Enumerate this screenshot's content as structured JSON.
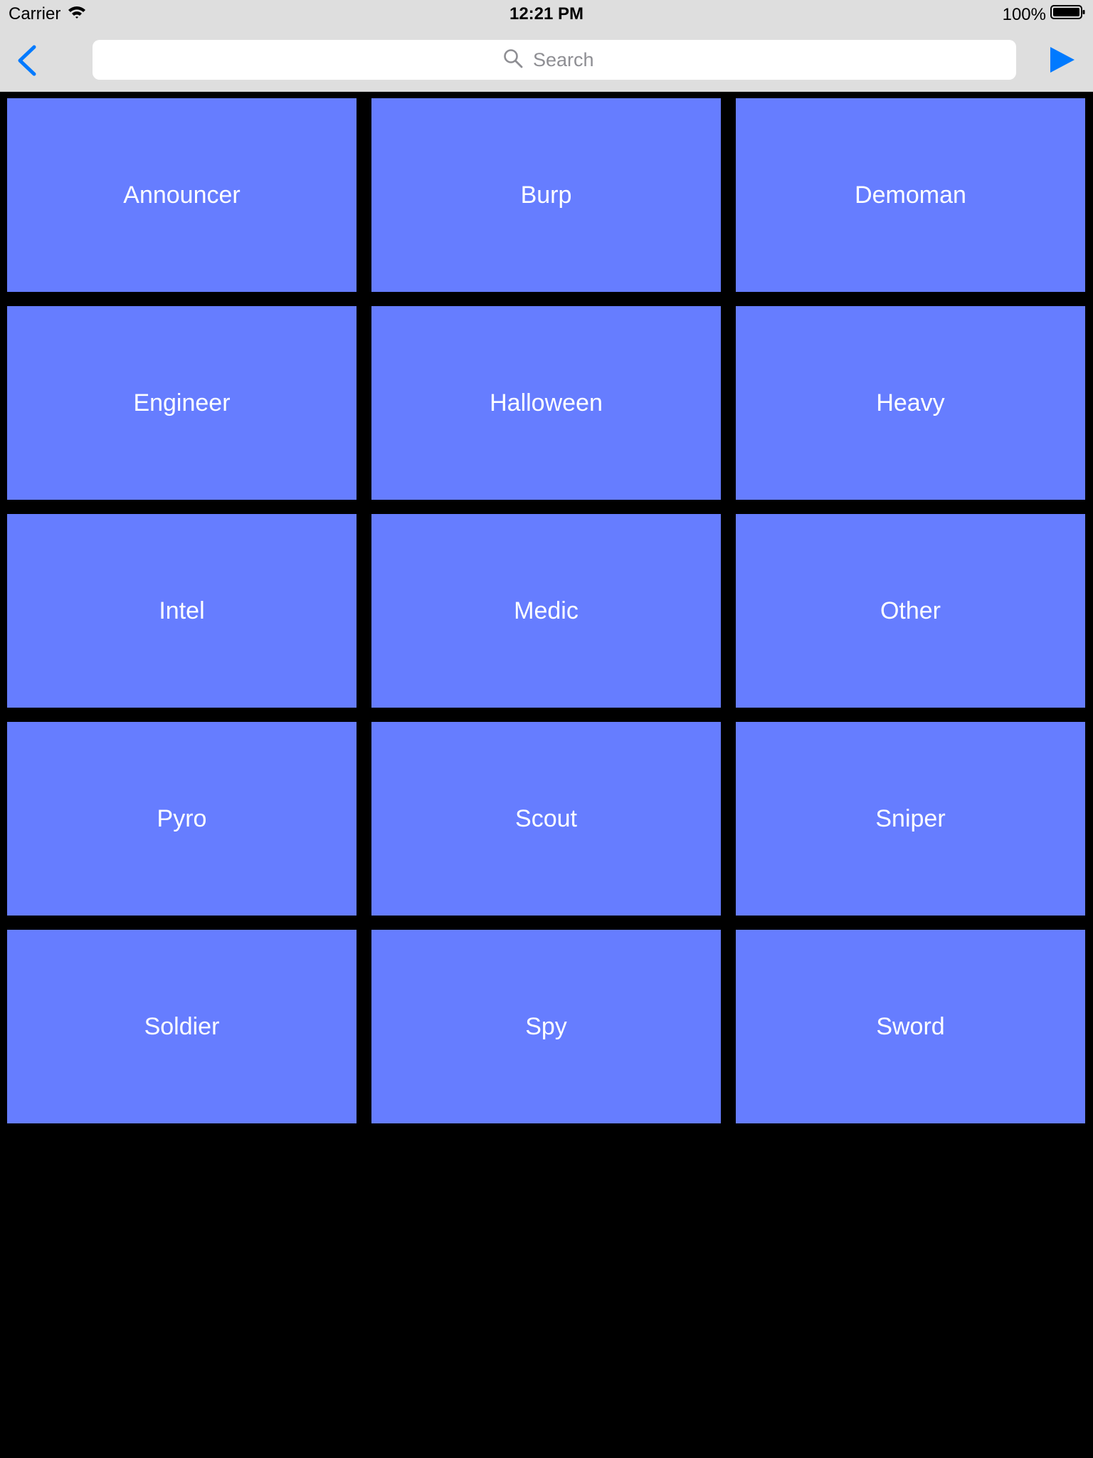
{
  "status_bar": {
    "carrier": "Carrier",
    "time": "12:21 PM",
    "battery": "100%",
    "icons": [
      "wifi-icon",
      "battery-icon"
    ]
  },
  "nav": {
    "back_icon": "chevron-left-icon",
    "search": {
      "placeholder": "Search",
      "value": "",
      "icon": "search-icon"
    },
    "play_icon": "play-icon"
  },
  "colors": {
    "accent": "#007aff",
    "tile": "#667dff",
    "background": "#000000",
    "bar": "#dedede"
  },
  "categories": [
    "Announcer",
    "Burp",
    "Demoman",
    "Engineer",
    "Halloween",
    "Heavy",
    "Intel",
    "Medic",
    "Other",
    "Pyro",
    "Scout",
    "Sniper",
    "Soldier",
    "Spy",
    "Sword"
  ]
}
